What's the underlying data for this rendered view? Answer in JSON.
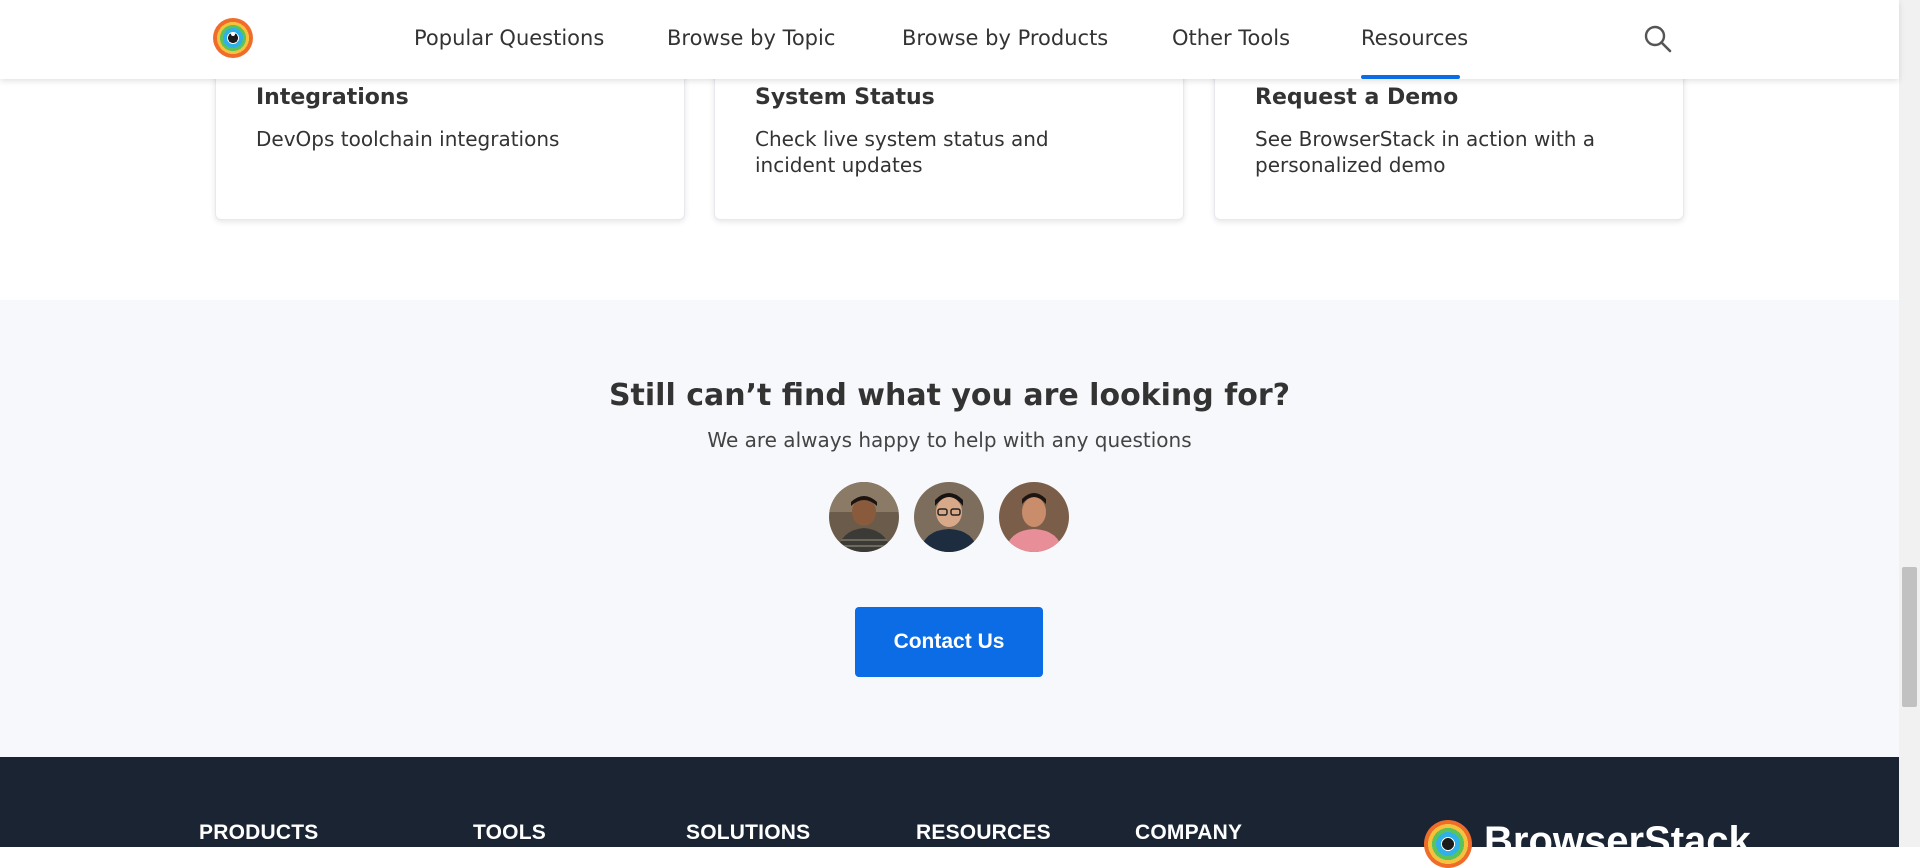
{
  "header": {
    "logo_icon": "browserstack-logo-icon",
    "nav": [
      {
        "label": "Popular Questions"
      },
      {
        "label": "Browse by Topic"
      },
      {
        "label": "Browse by Products"
      },
      {
        "label": "Other Tools"
      },
      {
        "label": "Resources",
        "active": true
      }
    ],
    "search_icon": "search-icon",
    "accent": "#0c6ce5"
  },
  "cards": [
    {
      "title": "Integrations",
      "description": "DevOps toolchain integrations"
    },
    {
      "title": "System Status",
      "description": "Check live system status and incident updates"
    },
    {
      "title": "Request a Demo",
      "description": "See BrowserStack in action with a personalized demo"
    }
  ],
  "help": {
    "title": "Still can’t find what you are looking for?",
    "subtitle": "We are always happy to help with any questions",
    "contact_label": "Contact Us"
  },
  "footer": {
    "columns": [
      "PRODUCTS",
      "TOOLS",
      "SOLUTIONS",
      "RESOURCES",
      "COMPANY"
    ],
    "brand": "BrowserStack",
    "background": "#1a2433"
  }
}
